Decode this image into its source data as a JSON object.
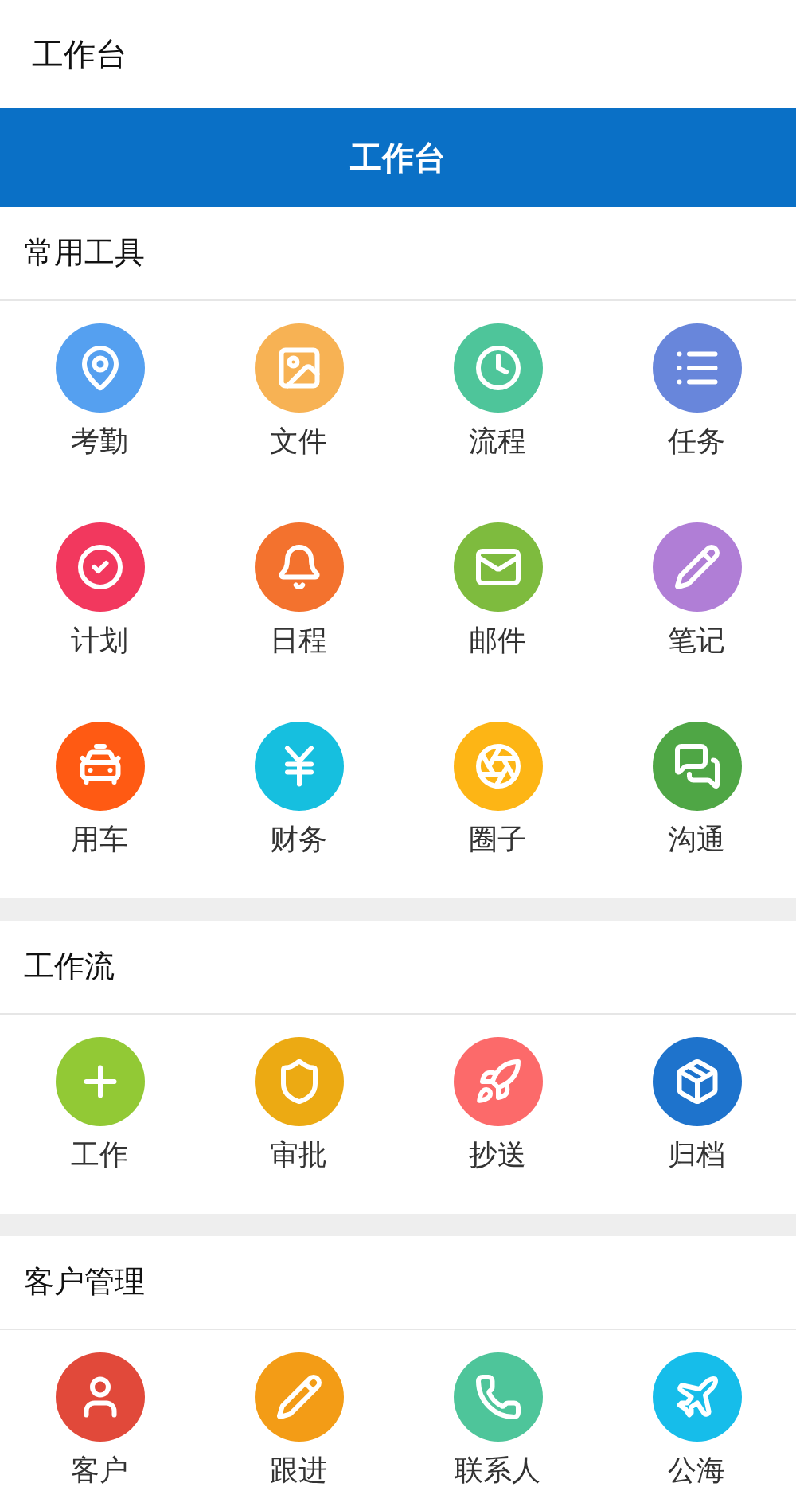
{
  "app_title": "工作台",
  "banner": {
    "title": "工作台"
  },
  "sections": [
    {
      "title": "常用工具",
      "items": [
        {
          "label": "考勤",
          "color": "#55a0f0"
        },
        {
          "label": "文件",
          "color": "#f7b254"
        },
        {
          "label": "流程",
          "color": "#4ec59a"
        },
        {
          "label": "任务",
          "color": "#6886db"
        },
        {
          "label": "计划",
          "color": "#f2385e"
        },
        {
          "label": "日程",
          "color": "#f3722e"
        },
        {
          "label": "邮件",
          "color": "#7ebb3e"
        },
        {
          "label": "笔记",
          "color": "#b07ed6"
        },
        {
          "label": "用车",
          "color": "#ff5a13"
        },
        {
          "label": "财务",
          "color": "#16bfdf"
        },
        {
          "label": "圈子",
          "color": "#fdb515"
        },
        {
          "label": "沟通",
          "color": "#4fa645"
        }
      ]
    },
    {
      "title": "工作流",
      "items": [
        {
          "label": "工作",
          "color": "#92c935"
        },
        {
          "label": "审批",
          "color": "#ecaa13"
        },
        {
          "label": "抄送",
          "color": "#fc6a6a"
        },
        {
          "label": "归档",
          "color": "#1e73cc"
        }
      ]
    },
    {
      "title": "客户管理",
      "items": [
        {
          "label": "客户",
          "color": "#e1493a"
        },
        {
          "label": "跟进",
          "color": "#f39c16"
        },
        {
          "label": "联系人",
          "color": "#4ec59a"
        },
        {
          "label": "公海",
          "color": "#16bdea"
        }
      ]
    }
  ]
}
